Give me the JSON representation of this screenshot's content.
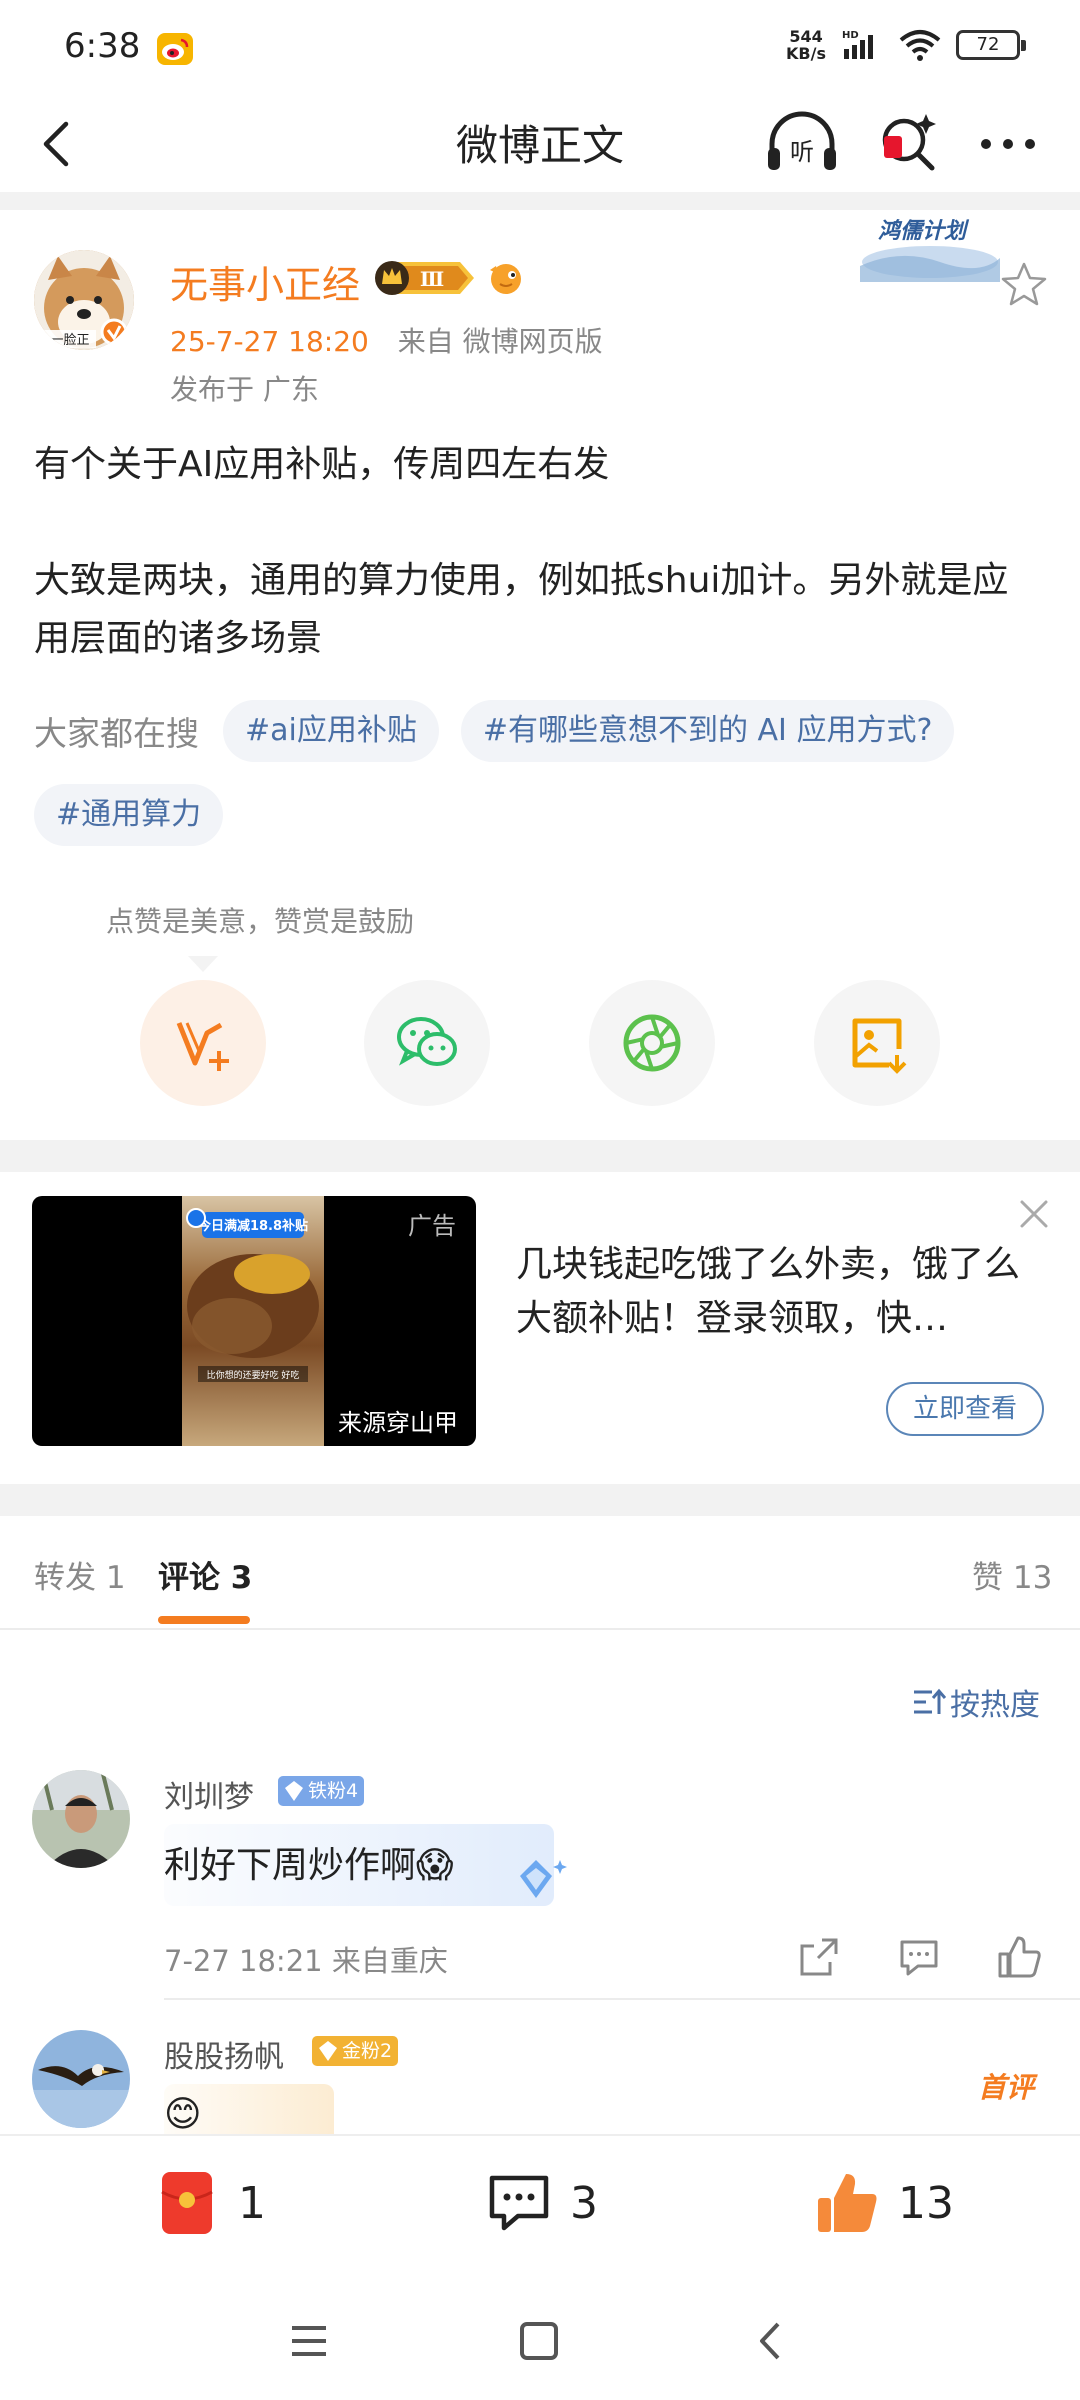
{
  "status_bar": {
    "time": "6:38",
    "net_speed_value": "544",
    "net_speed_unit": "KB/s",
    "network_type": "HD",
    "battery": "72"
  },
  "nav": {
    "title": "微博正文"
  },
  "post": {
    "author": "无事小正经",
    "avatar_label": "一脸正",
    "crown_level": "Ⅲ",
    "campaign_badge": "鸿儒计划",
    "time": "25-7-27 18:20",
    "source": "来自 微博网页版",
    "location": "发布于 广东",
    "paragraphs": [
      "有个关于AI应用补贴，传周四左右发",
      "",
      "大致是两块，通用的算力使用，例如抵shui加计。另外就是应用层面的诸多场景"
    ],
    "search_label": "大家都在搜",
    "topics": [
      "#ai应用补贴",
      "#有哪些意想不到的 AI 应用方式?",
      "#通用算力"
    ],
    "reward_tip": "点赞是美意，赞赏是鼓励"
  },
  "ad": {
    "tag": "广告",
    "source": "来源穿山甲",
    "title": "几块钱起吃饿了么外卖，饿了么大额补贴！登录领取，快…",
    "button": "立即查看",
    "image_banner": "今日满减18.8补贴",
    "image_caption": "比你想的还要好吃 好吃"
  },
  "tabs": {
    "repost_label": "转发",
    "repost_count": "1",
    "comment_label": "评论",
    "comment_count": "3",
    "like_label": "赞",
    "like_count": "13"
  },
  "sort_label": "按热度",
  "comments": [
    {
      "name": "刘圳梦",
      "badge": "铁粉4",
      "text": "利好下周炒作啊😱",
      "time": "7-27 18:21",
      "source": "来自重庆"
    },
    {
      "name": "股股扬帆",
      "badge": "金粉2",
      "hot": "首评",
      "text": "😊"
    }
  ],
  "bottom_bar": {
    "reward_count": "1",
    "comment_count": "3",
    "like_count": "13"
  },
  "colors": {
    "accent_orange": "#f47c20",
    "link_blue": "#4a6fa5",
    "iron_fan": "#7aa6e8",
    "gold_fan": "#f2b233",
    "wechat_green": "#2dbd6a"
  }
}
